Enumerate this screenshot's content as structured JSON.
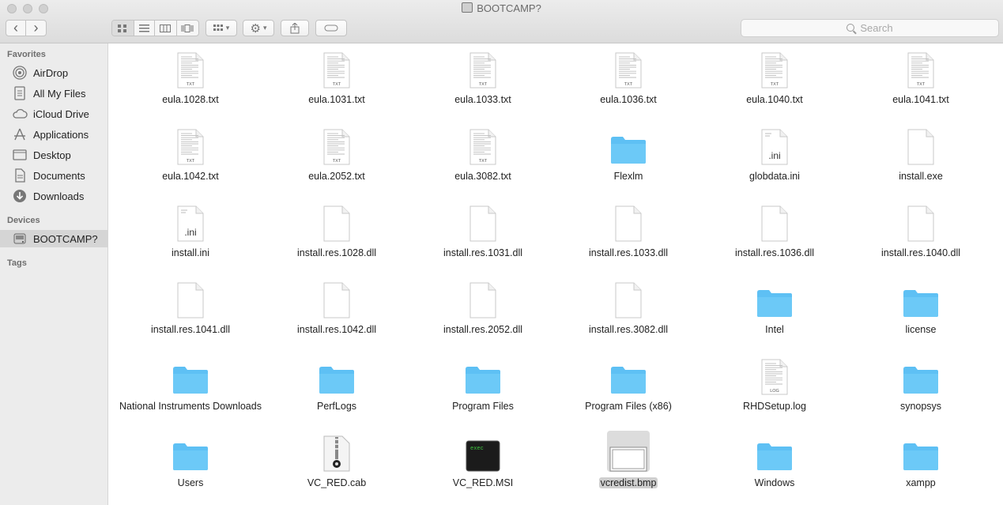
{
  "window": {
    "title": "BOOTCAMP?"
  },
  "toolbar": {
    "back": "‹",
    "forward": "›",
    "search_placeholder": "Search"
  },
  "sidebar": {
    "favorites_heading": "Favorites",
    "favorites": [
      {
        "label": "AirDrop",
        "icon": "airdrop-icon"
      },
      {
        "label": "All My Files",
        "icon": "all-files-icon"
      },
      {
        "label": "iCloud Drive",
        "icon": "cloud-icon"
      },
      {
        "label": "Applications",
        "icon": "applications-icon"
      },
      {
        "label": "Desktop",
        "icon": "desktop-icon"
      },
      {
        "label": "Documents",
        "icon": "documents-icon"
      },
      {
        "label": "Downloads",
        "icon": "downloads-icon"
      }
    ],
    "devices_heading": "Devices",
    "devices": [
      {
        "label": "BOOTCAMP?",
        "icon": "disk-icon",
        "selected": true
      }
    ],
    "tags_heading": "Tags"
  },
  "files": [
    {
      "name": "eula.1028.txt",
      "kind": "txt"
    },
    {
      "name": "eula.1031.txt",
      "kind": "txt"
    },
    {
      "name": "eula.1033.txt",
      "kind": "txt"
    },
    {
      "name": "eula.1036.txt",
      "kind": "txt"
    },
    {
      "name": "eula.1040.txt",
      "kind": "txt"
    },
    {
      "name": "eula.1041.txt",
      "kind": "txt"
    },
    {
      "name": "eula.1042.txt",
      "kind": "txt"
    },
    {
      "name": "eula.2052.txt",
      "kind": "txt"
    },
    {
      "name": "eula.3082.txt",
      "kind": "txt"
    },
    {
      "name": "Flexlm",
      "kind": "folder"
    },
    {
      "name": "globdata.ini",
      "kind": "ini"
    },
    {
      "name": "install.exe",
      "kind": "blank"
    },
    {
      "name": "install.ini",
      "kind": "ini"
    },
    {
      "name": "install.res.1028.dll",
      "kind": "blank"
    },
    {
      "name": "install.res.1031.dll",
      "kind": "blank"
    },
    {
      "name": "install.res.1033.dll",
      "kind": "blank"
    },
    {
      "name": "install.res.1036.dll",
      "kind": "blank"
    },
    {
      "name": "install.res.1040.dll",
      "kind": "blank"
    },
    {
      "name": "install.res.1041.dll",
      "kind": "blank"
    },
    {
      "name": "install.res.1042.dll",
      "kind": "blank"
    },
    {
      "name": "install.res.2052.dll",
      "kind": "blank"
    },
    {
      "name": "install.res.3082.dll",
      "kind": "blank"
    },
    {
      "name": "Intel",
      "kind": "folder"
    },
    {
      "name": "license",
      "kind": "folder"
    },
    {
      "name": "National Instruments Downloads",
      "kind": "folder"
    },
    {
      "name": "PerfLogs",
      "kind": "folder"
    },
    {
      "name": "Program Files",
      "kind": "folder"
    },
    {
      "name": "Program Files (x86)",
      "kind": "folder"
    },
    {
      "name": "RHDSetup.log",
      "kind": "log"
    },
    {
      "name": "synopsys",
      "kind": "folder"
    },
    {
      "name": "Users",
      "kind": "folder"
    },
    {
      "name": "VC_RED.cab",
      "kind": "cab"
    },
    {
      "name": "VC_RED.MSI",
      "kind": "exec"
    },
    {
      "name": "vcredist.bmp",
      "kind": "bmp",
      "selected": true
    },
    {
      "name": "Windows",
      "kind": "folder"
    },
    {
      "name": "xampp",
      "kind": "folder"
    }
  ],
  "icon_labels": {
    "txt": "TXT",
    "ini": ".ini",
    "log": "LOG",
    "exec": "exec"
  },
  "colors": {
    "folder": "#5ec0f4",
    "selection": "#d5d5d5"
  }
}
